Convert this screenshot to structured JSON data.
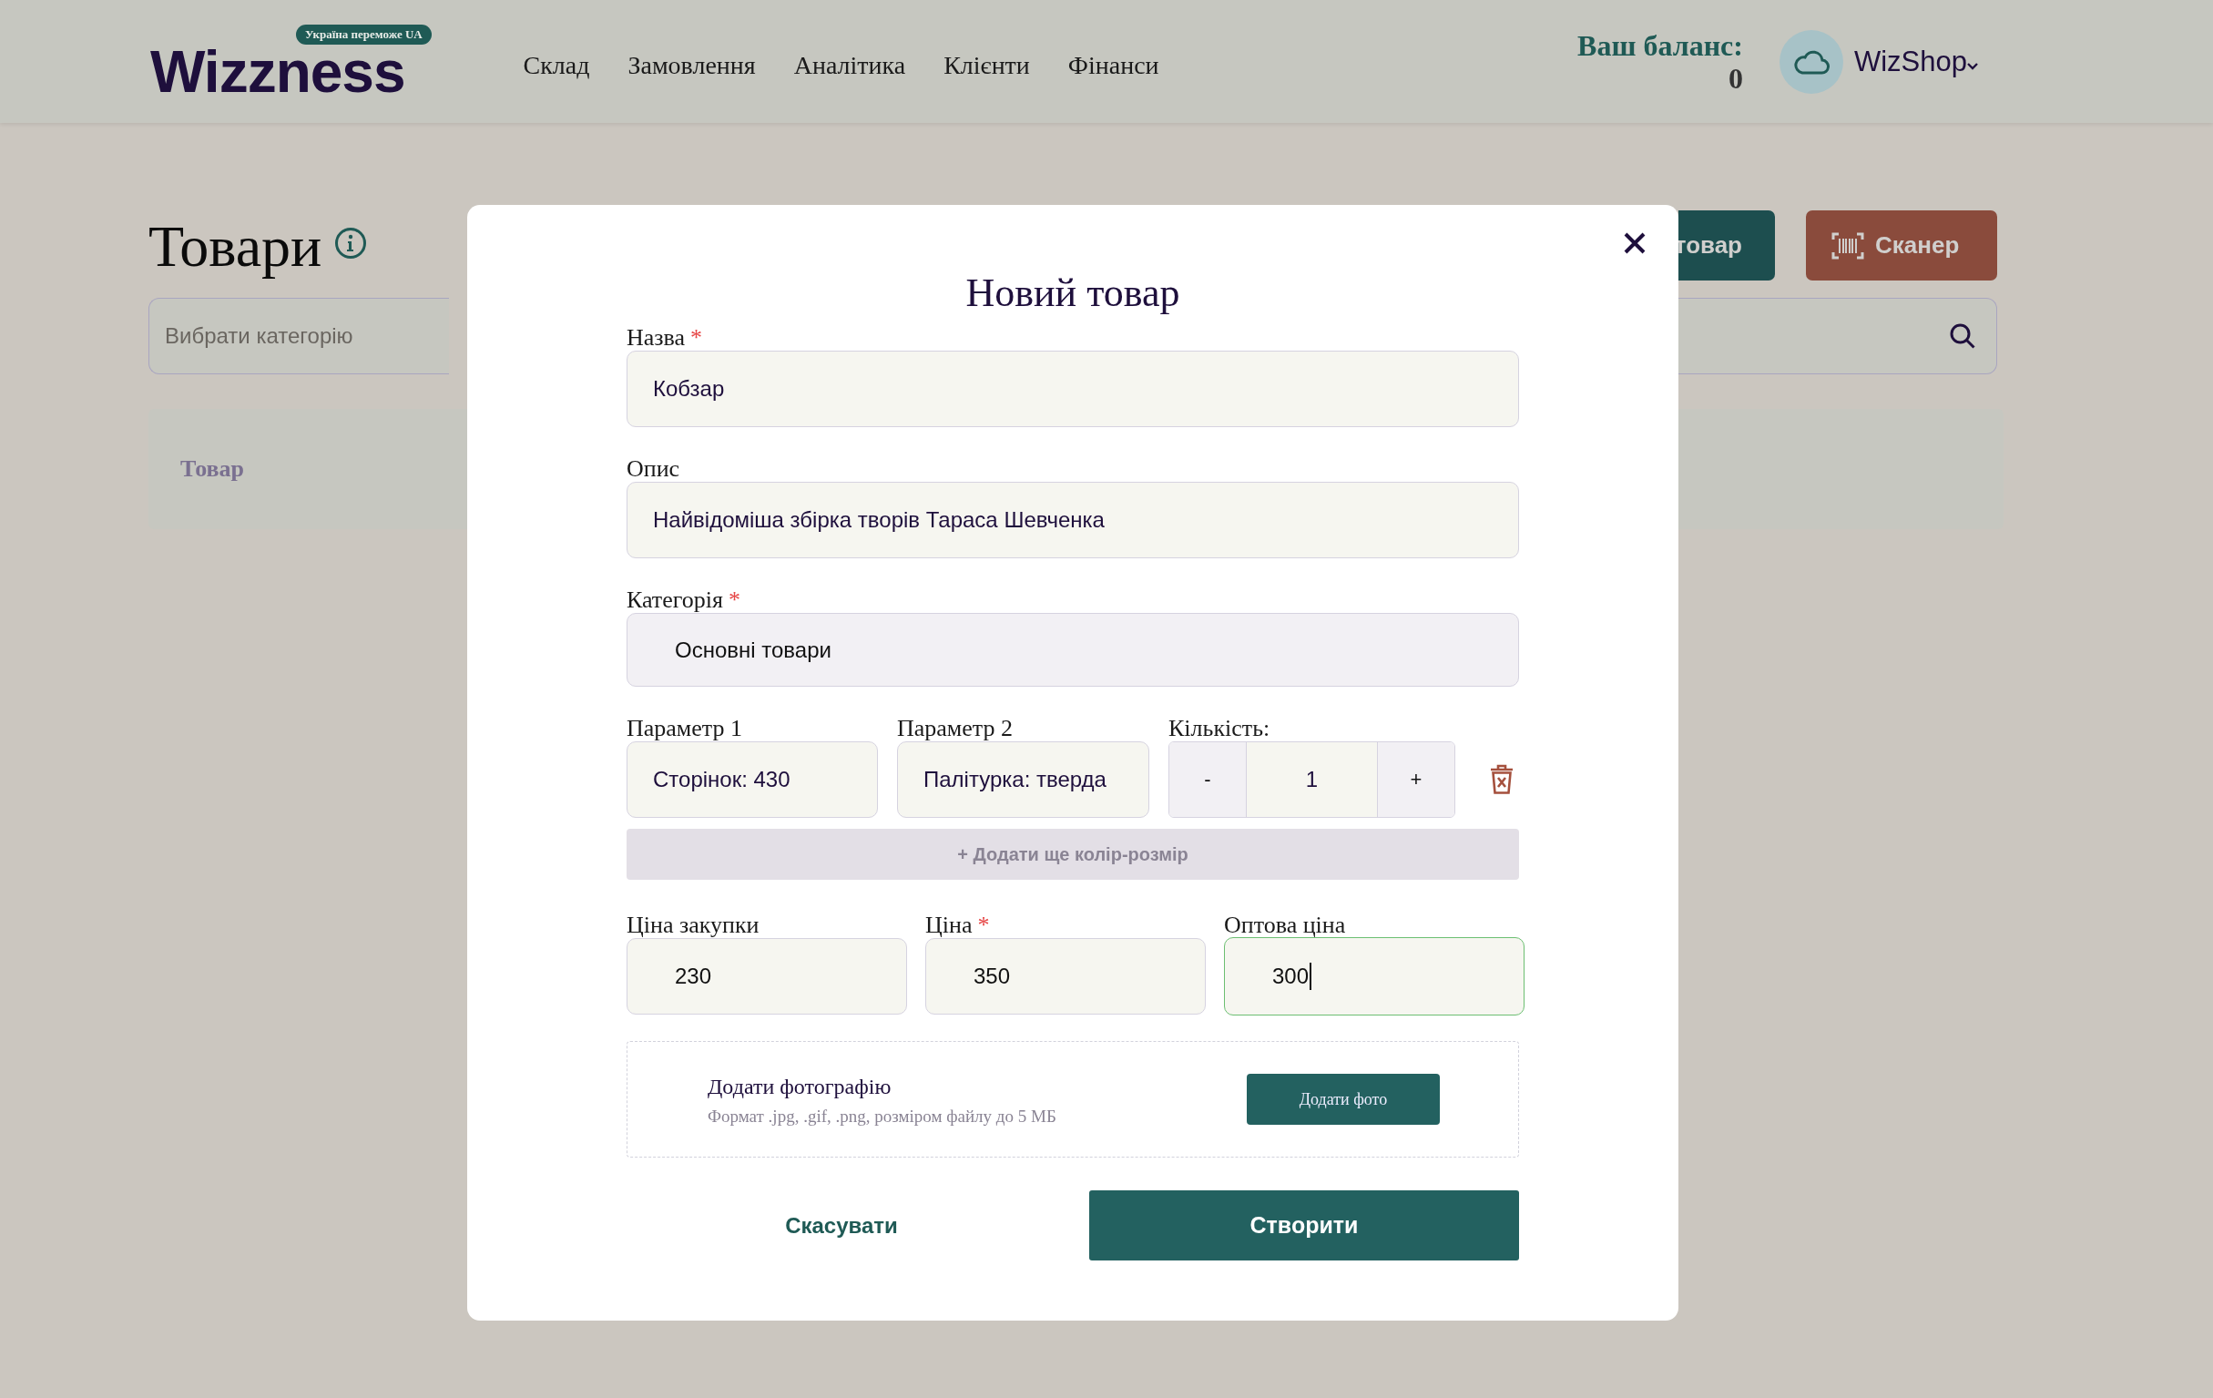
{
  "header": {
    "logo": "Wizzness",
    "badge": "Україна переможе UA",
    "nav": [
      {
        "label": "Склад"
      },
      {
        "label": "Замовлення"
      },
      {
        "label": "Аналітика"
      },
      {
        "label": "Клієнти"
      },
      {
        "label": "Фінанси"
      }
    ],
    "balance_label": "Ваш баланс:",
    "balance": "0",
    "account": "WizShop"
  },
  "page": {
    "title": "Товари",
    "buttons": [
      {
        "label": "товар",
        "kind": "primary"
      },
      {
        "label": "Сканер",
        "kind": "scanner"
      }
    ],
    "category_select": {
      "placeholder": "Вибрати категорію"
    },
    "table": {
      "columns": [
        "Товар"
      ]
    }
  },
  "modal": {
    "title": "Новий товар",
    "required_mark": "*",
    "fields": [
      {
        "label": "Назва",
        "required": true,
        "value": "Кобзар",
        "kind": "text"
      },
      {
        "label": "Опис",
        "required": false,
        "value": "Найвідоміша збірка творів Тараса Шевченка",
        "kind": "text"
      },
      {
        "label": "Категорія",
        "required": true,
        "value": "Основні товари",
        "kind": "select"
      }
    ],
    "variant_labels": [
      "Параметр 1",
      "Параметр 2",
      "Кількість:"
    ],
    "variants": [
      {
        "param_1": "Сторінок: 430",
        "param_2": "Палітурка: тверда",
        "quantity": "1",
        "minus": "-",
        "plus": "+"
      }
    ],
    "add_variant": "+ Додати ще колір-розмір",
    "prices": [
      {
        "label": "Ціна закупки",
        "required": false,
        "value": "230",
        "focused": false
      },
      {
        "label": "Ціна",
        "required": true,
        "value": "350",
        "focused": false
      },
      {
        "label": "Оптова ціна",
        "required": false,
        "value": "300",
        "focused": true
      }
    ],
    "photo": {
      "title": "Додати фотографію",
      "hint": "Формат .jpg, .gif, .png, розміром файлу до 5 МБ",
      "button": "Додати фото"
    },
    "actions": {
      "cancel": "Скасувати",
      "submit": "Створити"
    }
  }
}
